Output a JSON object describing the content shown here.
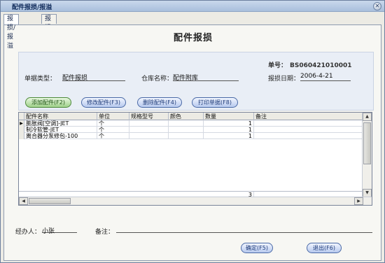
{
  "window": {
    "title": "配件报损/报溢",
    "close_glyph": "✕",
    "close_icon": "close-icon"
  },
  "tabs": [
    {
      "label": "报损/报溢",
      "active": true
    },
    {
      "label": "报损/报溢查询",
      "active": false
    }
  ],
  "form": {
    "title": "配件报损",
    "doc_no_label": "单号：",
    "doc_no": "BS060421010001",
    "doc_type_label": "单据类型：",
    "doc_type": "配件报损",
    "warehouse_label": "仓库名称：",
    "warehouse": "配件附库",
    "date_label": "报损日期：",
    "date": "2006-4-21"
  },
  "toolbar": {
    "add": "添加配件(F2)",
    "edit": "修改配件(F3)",
    "delete": "删除配件(F4)",
    "print": "打印单据(F8)"
  },
  "grid": {
    "columns": [
      "配件名称",
      "单位",
      "规格型号",
      "颜色",
      "数量",
      "备注"
    ],
    "rows": [
      [
        "膨胀阀[空调]-JET",
        "个",
        "",
        "",
        "1",
        ""
      ],
      [
        "制冷软管-JET",
        "个",
        "",
        "",
        "1",
        ""
      ],
      [
        "离合器分泵修包-100",
        "个",
        "",
        "",
        "1",
        ""
      ]
    ],
    "total_qty": "3",
    "row_marker": "▶",
    "scroll_up": "▲",
    "scroll_down": "▼",
    "scroll_left": "◀",
    "scroll_right": "▶"
  },
  "footer": {
    "handler_label": "经办人：",
    "handler": "小张",
    "remark_label": "备注：",
    "remark": "",
    "ok": "确定(F5)",
    "exit": "退出(F6)"
  },
  "colors": {
    "accent": "#4b6aa6",
    "green_button": "#9fd08a",
    "info_bg": "#e9eef6"
  }
}
